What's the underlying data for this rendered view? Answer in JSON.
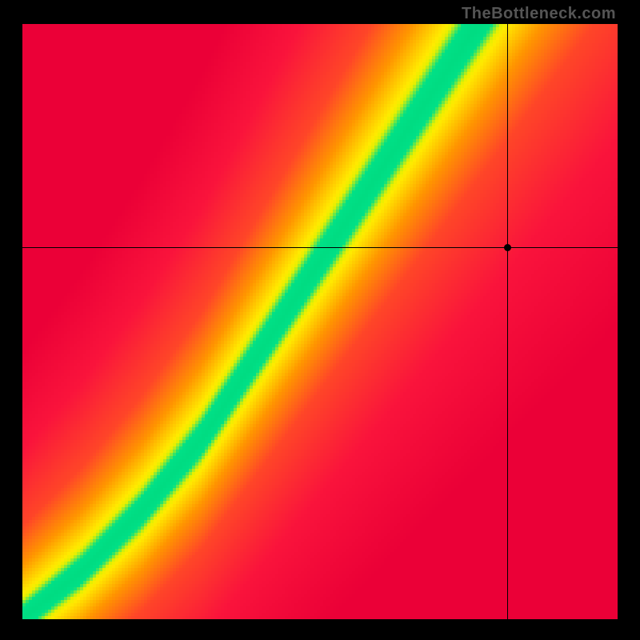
{
  "watermark": "TheBottleneck.com",
  "chart_data": {
    "type": "heatmap",
    "title": "",
    "xlabel": "",
    "ylabel": "",
    "xlim": [
      0,
      1
    ],
    "ylim": [
      0,
      1
    ],
    "grid": false,
    "legend": false,
    "colormap_description": "red → orange → yellow → green along optimal balance curve; red far from curve",
    "optimal_curve": {
      "description": "Approximate ideal y (GPU) for given x (CPU); green band center",
      "x": [
        0.0,
        0.1,
        0.2,
        0.3,
        0.4,
        0.5,
        0.6,
        0.7,
        0.8,
        0.9,
        1.0
      ],
      "y": [
        0.0,
        0.08,
        0.18,
        0.3,
        0.45,
        0.6,
        0.75,
        0.9,
        1.05,
        1.2,
        1.35
      ]
    },
    "marker": {
      "x": 0.815,
      "y": 0.625,
      "note": "black dot at crosshair intersection"
    },
    "crosshair": {
      "x": 0.815,
      "y": 0.625
    }
  }
}
